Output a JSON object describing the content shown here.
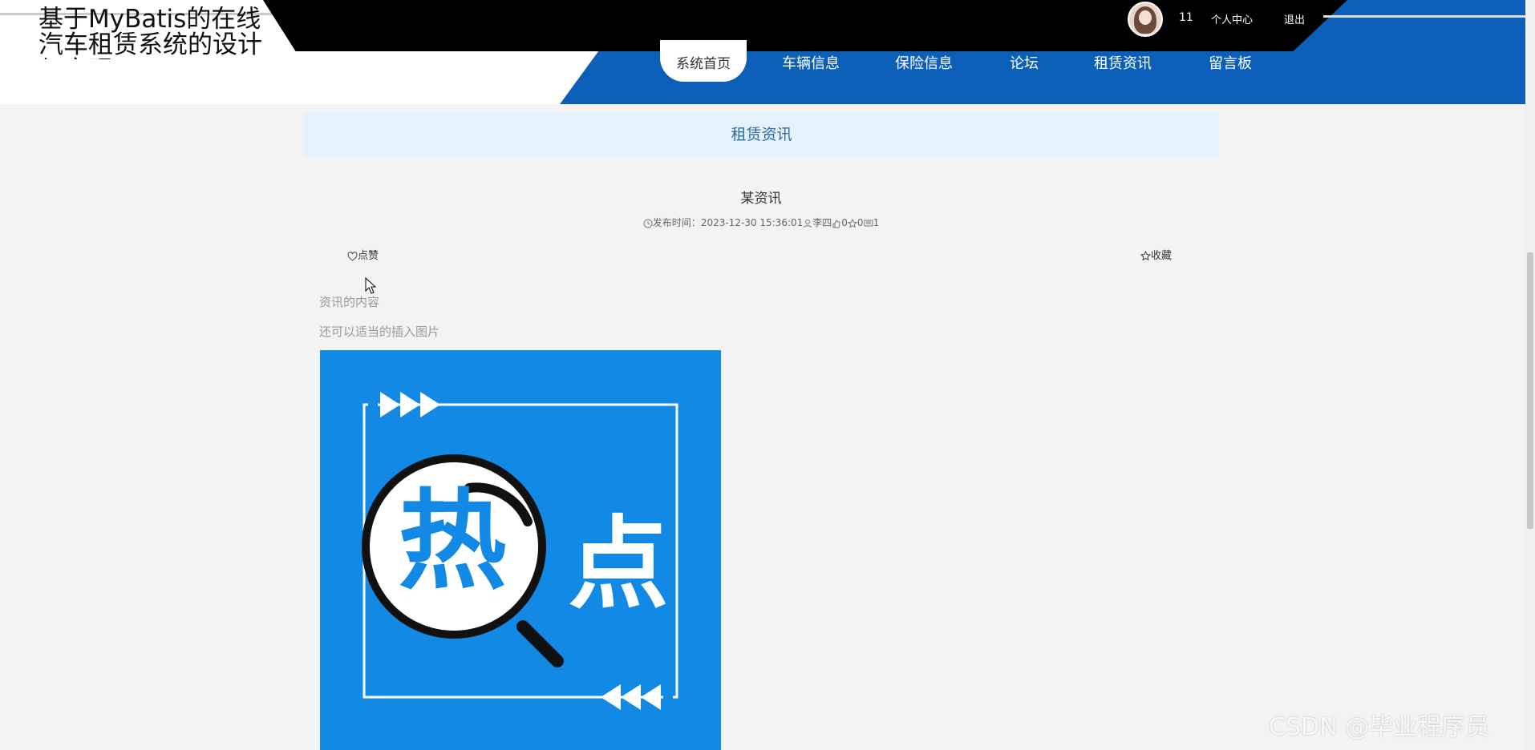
{
  "header": {
    "site_title": "基于MyBatis的在线汽车租赁系统的设计与实现",
    "username": "11",
    "user_center": "个人中心",
    "logout": "退出"
  },
  "nav": {
    "items": [
      {
        "label": "系统首页",
        "active": true
      },
      {
        "label": "车辆信息",
        "active": false
      },
      {
        "label": "保险信息",
        "active": false
      },
      {
        "label": "论坛",
        "active": false
      },
      {
        "label": "租赁资讯",
        "active": false
      },
      {
        "label": "留言板",
        "active": false
      }
    ]
  },
  "section": {
    "title": "租赁资讯"
  },
  "article": {
    "title": "某资讯",
    "publish_label": "发布时间：",
    "publish_time": "2023-12-30 15:36:01",
    "author": "李四",
    "likes": "0",
    "favorites": "0",
    "views": "1",
    "like_label": "点赞",
    "favorite_label": "收藏",
    "content_lines": [
      "资讯的内容",
      "还可以适当的插入图片"
    ],
    "image": {
      "chars": [
        "热",
        "点"
      ],
      "color": "#1389e6"
    }
  },
  "watermark": "CSDN @毕业程序员",
  "icons": [
    "clock-icon",
    "user-icon",
    "thumb-icon",
    "star-icon",
    "comment-icon",
    "heart-icon",
    "magnifier-icon",
    "cursor-icon"
  ],
  "colors": {
    "primary_blue": "#0b5fb8",
    "band_bg": "#e5f1fb",
    "band_text": "#2b6aa3",
    "header_black": "#000000"
  }
}
